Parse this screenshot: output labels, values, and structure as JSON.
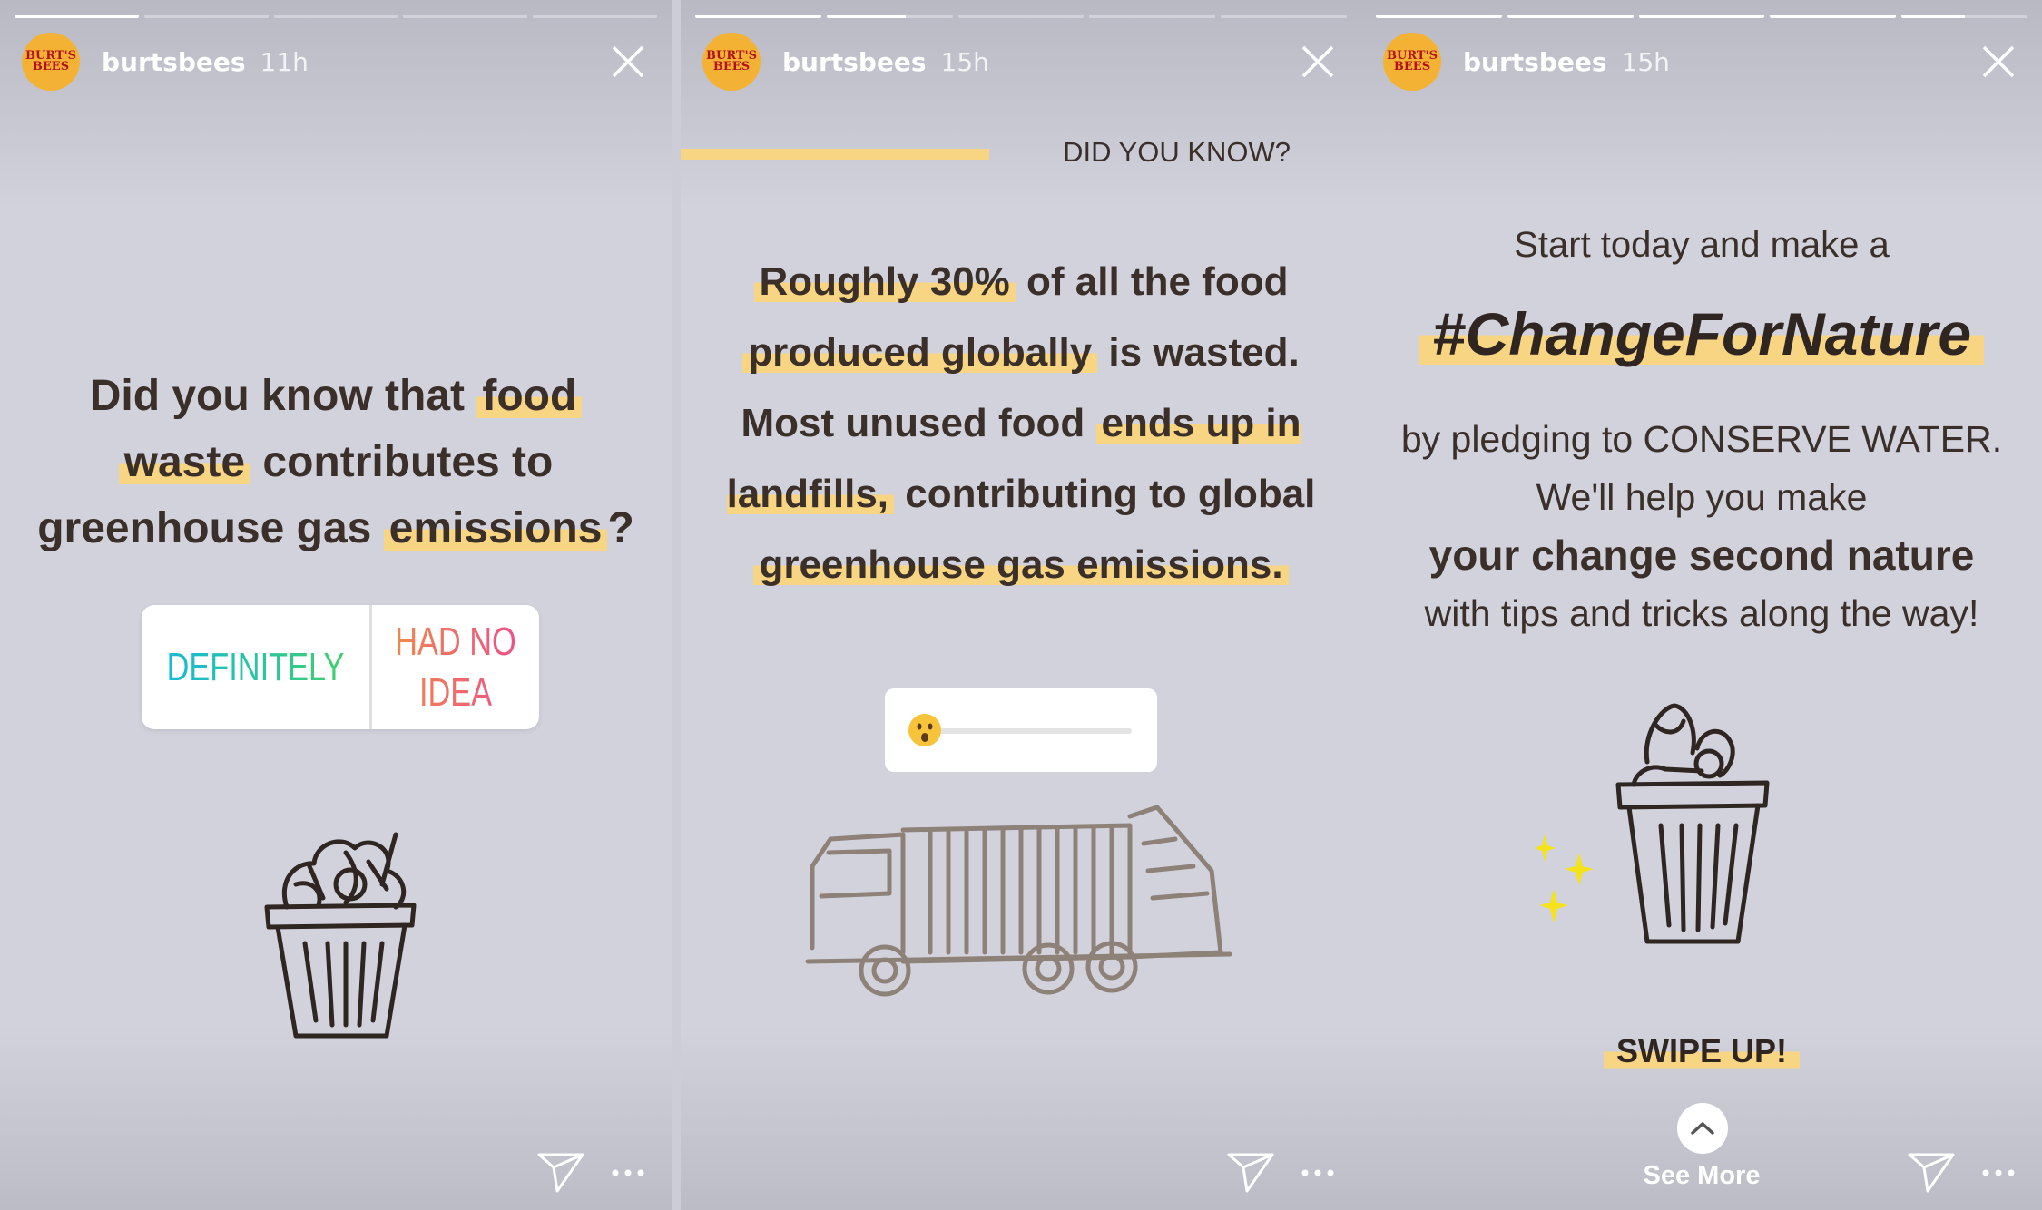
{
  "stories": [
    {
      "progress": [
        1,
        0,
        0,
        0,
        0
      ],
      "account": {
        "logo_line1": "BURT'S",
        "logo_line2": "BEES",
        "username": "burtsbees",
        "time": "11h"
      },
      "question": {
        "pre": "Did you know that ",
        "w1": "food",
        "w2": "waste",
        "mid": " contributes to greenhouse gas ",
        "w3": "emissions",
        "end": "?"
      },
      "poll": {
        "option_a": "DEFINITELY",
        "option_b": "HAD NO IDEA"
      }
    },
    {
      "progress": [
        1,
        0.63,
        0,
        0,
        0
      ],
      "account": {
        "logo_line1": "BURT'S",
        "logo_line2": "BEES",
        "username": "burtsbees",
        "time": "15h"
      },
      "label": "DID YOU KNOW?",
      "fact": {
        "h1": "Roughly 30%",
        "t1": " of all the food ",
        "h2": "produced globally",
        "t2": " is wasted. Most unused food ",
        "h3": "ends up in landfills,",
        "t3": " contributing to global ",
        "h4": "greenhouse gas emissions."
      },
      "slider": {
        "emoji": "surprised-face",
        "value": 0
      }
    },
    {
      "progress": [
        1,
        1,
        1,
        1,
        0.5
      ],
      "account": {
        "logo_line1": "BURT'S",
        "logo_line2": "BEES",
        "username": "burtsbees",
        "time": "15h"
      },
      "intro": "Start today and make a",
      "hashtag": "#ChangeForNature",
      "body1": "by pledging to CONSERVE WATER. We'll help you make",
      "body_bold": "your change second nature",
      "body2": "with tips and tricks along the way!",
      "swipe": "SWIPE UP!",
      "see_more": "See More"
    }
  ],
  "colors": {
    "highlight": "#f8d582",
    "text": "#3a2f29",
    "logo": "#f3b233",
    "logo_text": "#b3121d"
  }
}
